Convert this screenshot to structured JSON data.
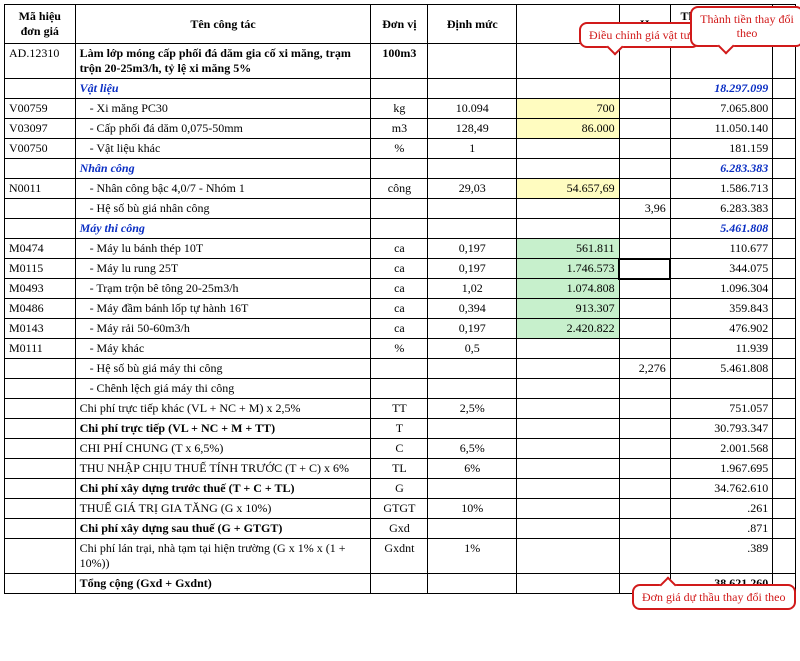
{
  "headers": {
    "code": "Mã hiệu đơn giá",
    "name": "Tên công tác",
    "unit": "Đơn vị",
    "dm": "Định mức",
    "price": "",
    "factor": "H",
    "total": "Thành tiền thay đổi theo",
    "extra": ""
  },
  "callouts": {
    "c1": "Điều chỉnh giá vật tư",
    "c2": "Thành tiền thay đổi theo",
    "c3": "Đơn giá dự thầu thay đổi theo"
  },
  "rows": [
    {
      "code": "AD.12310",
      "name": "Làm lớp móng cấp phối đá dăm gia cố xi măng, trạm trộn 20-25m3/h, tỷ lệ xi măng 5%",
      "nameCls": "bold",
      "unit": "100m3",
      "dm": "",
      "price": "",
      "factor": "",
      "total": "",
      "unitBold": true
    },
    {
      "code": "",
      "name": "Vật liệu",
      "nameCls": "blue-italic",
      "unit": "",
      "dm": "",
      "price": "",
      "factor": "",
      "total": "18.297.099",
      "totalCls": "blue-total"
    },
    {
      "code": "V00759",
      "name": "- Xi măng PC30",
      "nameCls": "indent1",
      "unit": "kg",
      "dm": "10.094",
      "price": "700",
      "priceCls": "hl-yellow",
      "factor": "",
      "total": "7.065.800"
    },
    {
      "code": "V03097",
      "name": "- Cấp phối đá dăm 0,075-50mm",
      "nameCls": "indent1",
      "unit": "m3",
      "dm": "128,49",
      "price": "86.000",
      "priceCls": "hl-yellow",
      "factor": "",
      "total": "11.050.140"
    },
    {
      "code": "V00750",
      "name": "- Vật liệu khác",
      "nameCls": "indent1",
      "unit": "%",
      "dm": "1",
      "price": "",
      "factor": "",
      "total": "181.159"
    },
    {
      "code": "",
      "name": "Nhân công",
      "nameCls": "blue-italic",
      "unit": "",
      "dm": "",
      "price": "",
      "factor": "",
      "total": "6.283.383",
      "totalCls": "blue-total"
    },
    {
      "code": "N0011",
      "name": "- Nhân công bậc 4,0/7 - Nhóm 1",
      "nameCls": "indent1",
      "unit": "công",
      "dm": "29,03",
      "price": "54.657,69",
      "priceCls": "hl-yellow",
      "factor": "",
      "total": "1.586.713"
    },
    {
      "code": "",
      "name": "- Hệ số bù giá nhân công",
      "nameCls": "indent1",
      "unit": "",
      "dm": "",
      "price": "",
      "factor": "3,96",
      "total": "6.283.383"
    },
    {
      "code": "",
      "name": "Máy thi công",
      "nameCls": "blue-italic",
      "unit": "",
      "dm": "",
      "price": "",
      "factor": "",
      "total": "5.461.808",
      "totalCls": "blue-total"
    },
    {
      "code": "M0474",
      "name": "- Máy lu bánh thép 10T",
      "nameCls": "indent1",
      "unit": "ca",
      "dm": "0,197",
      "price": "561.811",
      "priceCls": "hl-green",
      "factor": "",
      "total": "110.677"
    },
    {
      "code": "M0115",
      "name": "- Máy lu rung 25T",
      "nameCls": "indent1",
      "unit": "ca",
      "dm": "0,197",
      "price": "1.746.573",
      "priceCls": "hl-green",
      "factor": "",
      "factorCls": "sel-black",
      "total": "344.075"
    },
    {
      "code": "M0493",
      "name": "- Trạm trộn bê tông 20-25m3/h",
      "nameCls": "indent1",
      "unit": "ca",
      "dm": "1,02",
      "price": "1.074.808",
      "priceCls": "hl-green",
      "factor": "",
      "total": "1.096.304"
    },
    {
      "code": "M0486",
      "name": "- Máy đầm bánh lốp tự hành 16T",
      "nameCls": "indent1",
      "unit": "ca",
      "dm": "0,394",
      "price": "913.307",
      "priceCls": "hl-green",
      "factor": "",
      "total": "359.843"
    },
    {
      "code": "M0143",
      "name": "- Máy rải 50-60m3/h",
      "nameCls": "indent1",
      "unit": "ca",
      "dm": "0,197",
      "price": "2.420.822",
      "priceCls": "hl-green",
      "factor": "",
      "total": "476.902"
    },
    {
      "code": "M0111",
      "name": "- Máy khác",
      "nameCls": "indent1",
      "unit": "%",
      "dm": "0,5",
      "price": "",
      "factor": "",
      "total": "11.939"
    },
    {
      "code": "",
      "name": "- Hệ số bù giá máy thi công",
      "nameCls": "indent1",
      "unit": "",
      "dm": "",
      "price": "",
      "factor": "2,276",
      "total": "5.461.808"
    },
    {
      "code": "",
      "name": "- Chênh lệch giá máy thi công",
      "nameCls": "indent1",
      "unit": "",
      "dm": "",
      "price": "",
      "factor": "",
      "total": ""
    },
    {
      "code": "",
      "name": "Chi phí trực tiếp khác (VL + NC + M) x 2,5%",
      "nameCls": "",
      "unit": "TT",
      "dm": "2,5%",
      "price": "",
      "factor": "",
      "total": "751.057"
    },
    {
      "code": "",
      "name": "Chi phí trực tiếp (VL + NC + M + TT)",
      "nameCls": "bold",
      "unit": "T",
      "dm": "",
      "price": "",
      "factor": "",
      "total": "30.793.347"
    },
    {
      "code": "",
      "name": "CHI PHÍ CHUNG (T x 6,5%)",
      "nameCls": "",
      "unit": "C",
      "dm": "6,5%",
      "price": "",
      "factor": "",
      "total": "2.001.568"
    },
    {
      "code": "",
      "name": "THU NHẬP CHỊU THUẾ TÍNH TRƯỚC (T + C) x 6%",
      "nameCls": "",
      "unit": "TL",
      "dm": "6%",
      "price": "",
      "factor": "",
      "total": "1.967.695"
    },
    {
      "code": "",
      "name": "Chi phí xây dựng trước thuế (T + C + TL)",
      "nameCls": "bold",
      "unit": "G",
      "dm": "",
      "price": "",
      "factor": "",
      "total": "34.762.610"
    },
    {
      "code": "",
      "name": "THUẾ GIÁ TRỊ GIA TĂNG (G x 10%)",
      "nameCls": "",
      "unit": "GTGT",
      "dm": "10%",
      "price": "",
      "factor": "",
      "total": ".261"
    },
    {
      "code": "",
      "name": "Chi phí xây dựng sau thuế (G + GTGT)",
      "nameCls": "bold",
      "unit": "Gxd",
      "dm": "",
      "price": "",
      "factor": "",
      "total": ".871"
    },
    {
      "code": "",
      "name": "Chi phí lán trại, nhà tạm tại hiện trường (G x 1% x (1 + 10%))",
      "nameCls": "",
      "unit": "Gxdnt",
      "dm": "1%",
      "price": "",
      "factor": "",
      "total": ".389"
    },
    {
      "code": "",
      "name": "Tổng cộng (Gxd + Gxdnt)",
      "nameCls": "bold",
      "unit": "",
      "dm": "",
      "price": "",
      "factor": "",
      "total": "38.621.260",
      "totalCls": "bold"
    }
  ]
}
